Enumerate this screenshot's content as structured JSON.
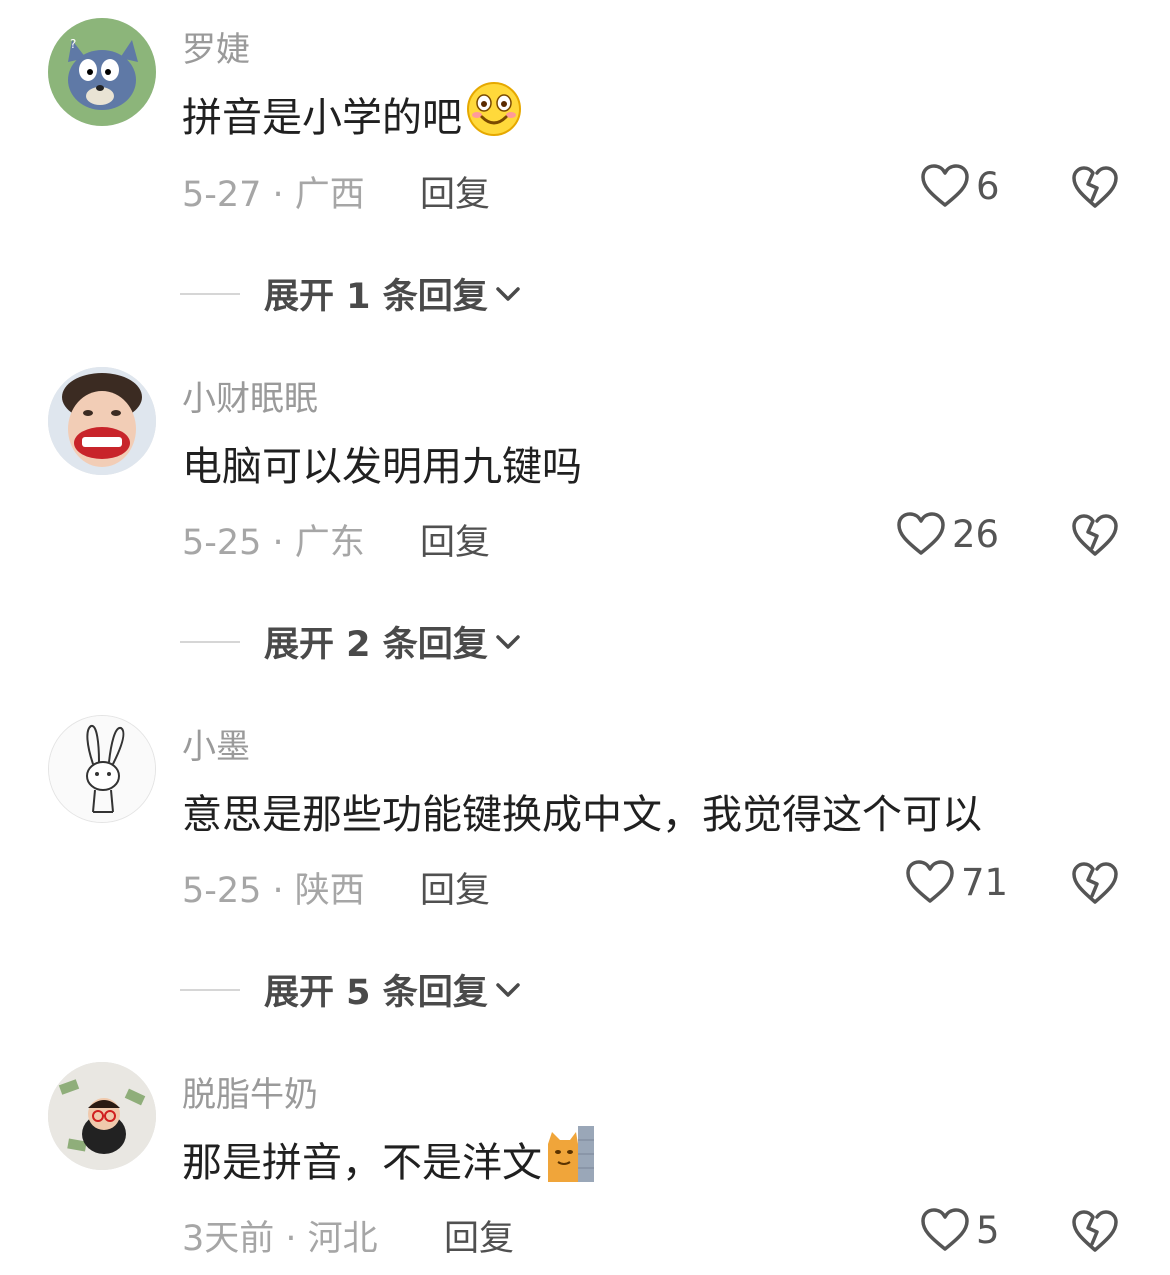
{
  "comments": [
    {
      "username": "罗婕",
      "text": "拼音是小学的吧",
      "emoji": "smiling-face-emoji",
      "date_location": "5-27 · 广西",
      "reply_label": "回复",
      "likes": "6",
      "expand_label": "展开 1 条回复"
    },
    {
      "username": "小财眠眠",
      "text": "电脑可以发明用九键吗",
      "date_location": "5-25 · 广东",
      "reply_label": "回复",
      "likes": "26",
      "expand_label": "展开 2 条回复"
    },
    {
      "username": "小墨",
      "text": "意思是那些功能键换成中文，我觉得这个可以",
      "date_location": "5-25 · 陕西",
      "reply_label": "回复",
      "likes": "71",
      "expand_label": "展开 5 条回复"
    },
    {
      "username": "脱脂牛奶",
      "text": "那是拼音，不是洋文",
      "emoji": "cat-peeking-sticker",
      "date_location": "3天前 · 河北",
      "reply_label": "回复",
      "likes": "5"
    }
  ],
  "colors": {
    "username": "#9a9a9a",
    "meta": "#a6a6a6",
    "text": "#202020",
    "icon": "#555555"
  }
}
